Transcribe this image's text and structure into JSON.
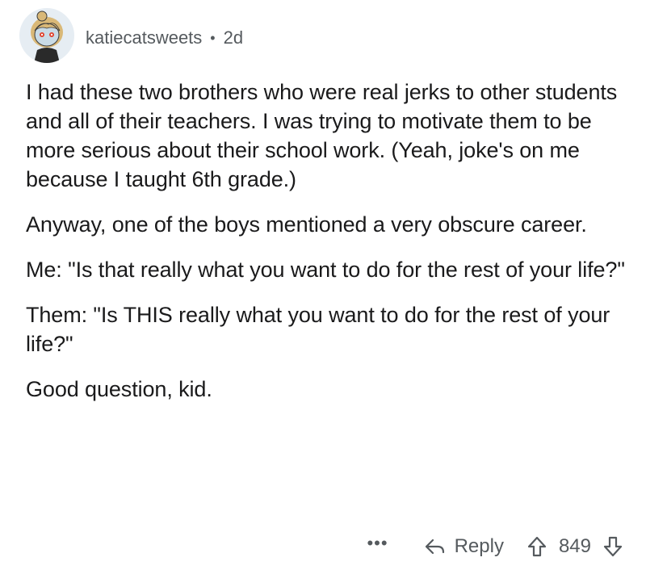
{
  "comment": {
    "username": "katiecatsweets",
    "separator": "•",
    "age": "2d",
    "paragraphs": [
      "I had these two brothers who were real jerks to other students and all of their teachers. I was trying to motivate them to be more serious about their school work. (Yeah, joke's on me because I taught 6th grade.)",
      "Anyway, one of the boys mentioned a very obscure career.",
      "Me: \"Is that really what you want to do for the rest of your life?\"",
      "Them: \"Is THIS really what you want to do for the rest of your life?\"",
      "Good question, kid."
    ]
  },
  "actions": {
    "more_label": "•••",
    "reply_label": "Reply",
    "score": "849",
    "icons": {
      "more": "more-options-icon",
      "reply": "reply-arrow-icon",
      "upvote": "upvote-arrow-icon",
      "downvote": "downvote-arrow-icon"
    }
  },
  "colors": {
    "text": "#1a1a1b",
    "meta": "#555a5e",
    "avatar_bg": "#e6edf3"
  }
}
